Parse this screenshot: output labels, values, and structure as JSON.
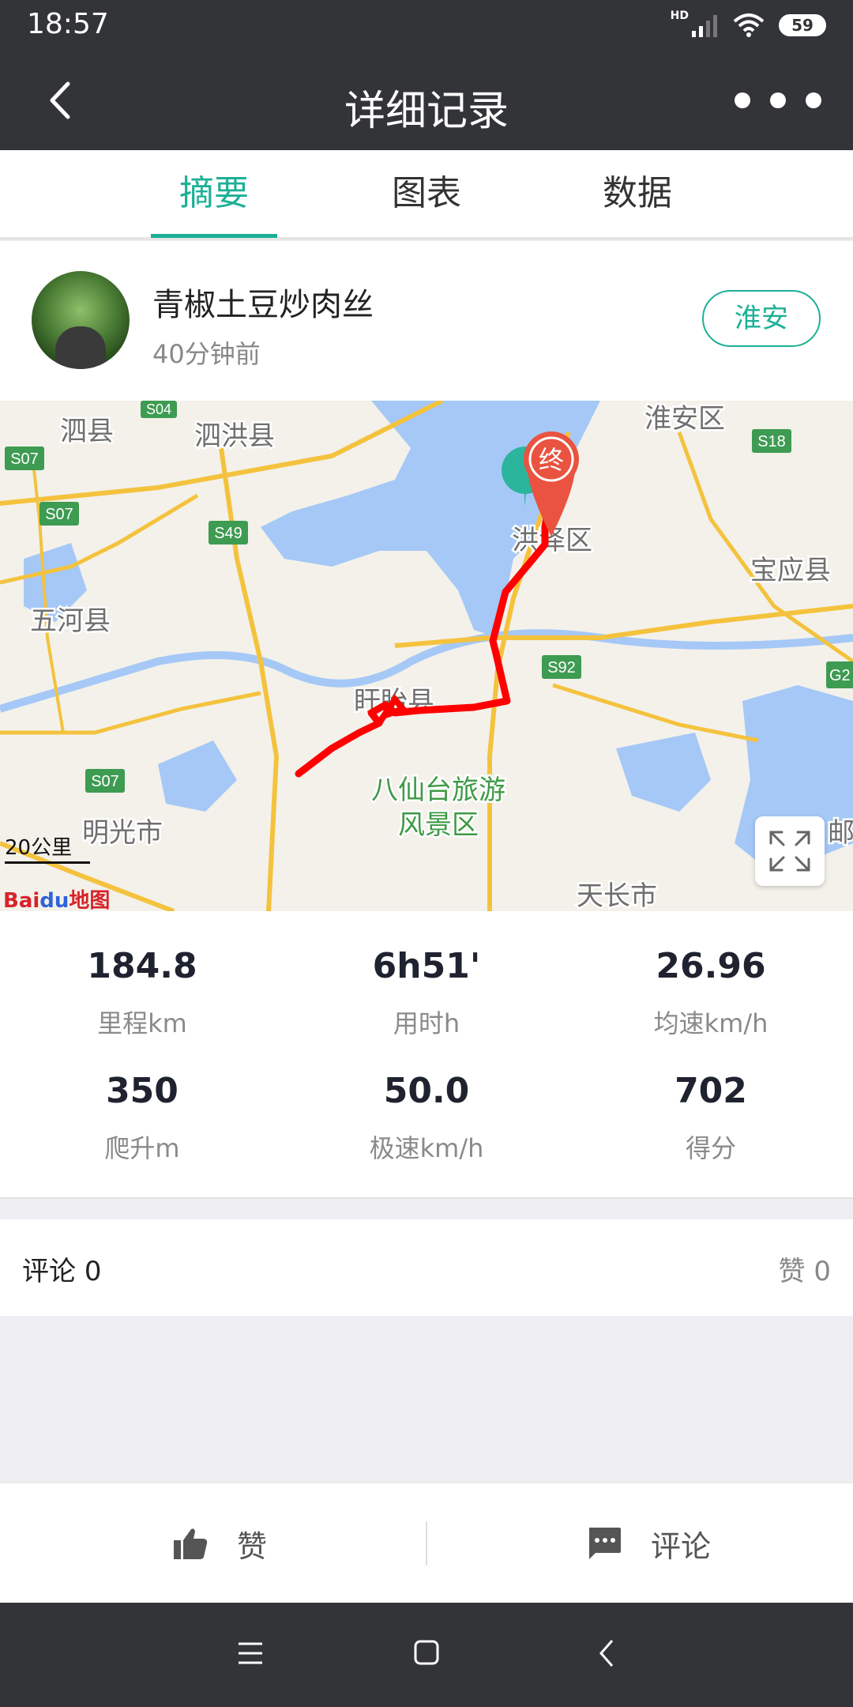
{
  "status_bar": {
    "time": "18:57",
    "network": "HD",
    "battery": "59"
  },
  "title_bar": {
    "title": "详细记录"
  },
  "tabs": [
    {
      "label": "摘要",
      "active": true
    },
    {
      "label": "图表",
      "active": false
    },
    {
      "label": "数据",
      "active": false
    }
  ],
  "user": {
    "name": "青椒土豆炒肉丝",
    "time_ago": "40分钟前",
    "location": "淮安"
  },
  "map": {
    "labels": {
      "sixian": "泗县",
      "sihong": "泗洪县",
      "huaian": "淮安区",
      "hongze": "洪泽区",
      "baoying": "宝应县",
      "wuhe": "五河县",
      "xuyi": "盱眙县",
      "baxiantai": "八仙台旅游",
      "scenic": "风景区",
      "mingguang": "明光市",
      "tianchang": "天长市",
      "edge_right": "邮"
    },
    "roads": {
      "s04": "S04",
      "s07a": "S07",
      "s07b": "S07",
      "s07c": "S07",
      "s49": "S49",
      "s18": "S18",
      "s92": "S92",
      "g2": "G2"
    },
    "end_marker": "终",
    "start_marker": "起",
    "scale": "20公里",
    "logo": "Bai地图",
    "logo_parts": {
      "bai": "Bai",
      "du": "du",
      "map": "地图"
    },
    "colors": {
      "route": "#ff0000",
      "water": "#a5c8f7",
      "road": "#f4c23d",
      "end_marker": "#e9533f",
      "start_marker": "#2ab59c"
    }
  },
  "stats": [
    {
      "value": "184.8",
      "label": "里程km"
    },
    {
      "value": "6h51'",
      "label": "用时h"
    },
    {
      "value": "26.96",
      "label": "均速km/h"
    },
    {
      "value": "350",
      "label": "爬升m"
    },
    {
      "value": "50.0",
      "label": "极速km/h"
    },
    {
      "value": "702",
      "label": "得分"
    }
  ],
  "comments": {
    "comment_label": "评论",
    "comment_count": "0",
    "like_label": "赞",
    "like_count": "0"
  },
  "actions": {
    "like": "赞",
    "comment": "评论"
  },
  "colors": {
    "accent": "#1db096",
    "header_bg": "#333437"
  }
}
